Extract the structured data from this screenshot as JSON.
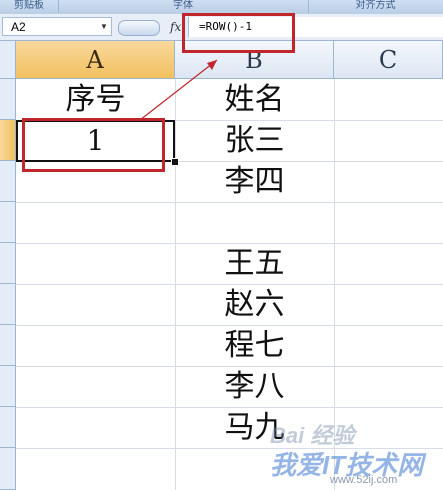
{
  "ribbon": {
    "groups": [
      "剪贴板",
      "字体",
      "对齐方式"
    ]
  },
  "formula_bar": {
    "name_box": "A2",
    "fx_label": "fx",
    "formula": "=ROW()-1"
  },
  "sheet": {
    "columns": [
      "A",
      "B",
      "C"
    ],
    "active_column": "A",
    "active_row": 2,
    "cells": {
      "A1": "序号",
      "A2": "1",
      "B1": "姓名",
      "B2": "张三",
      "B3": "李四",
      "B5": "王五",
      "B6": "赵六",
      "B7": "程七",
      "B8": "李八",
      "B9": "马九"
    }
  },
  "watermark": {
    "line1": "Bai 经验",
    "line2": "我爱IT技术网",
    "line3": "www.52ij.com"
  },
  "colors": {
    "highlight_red": "#c0262b",
    "active_header": "#f1c15f"
  }
}
